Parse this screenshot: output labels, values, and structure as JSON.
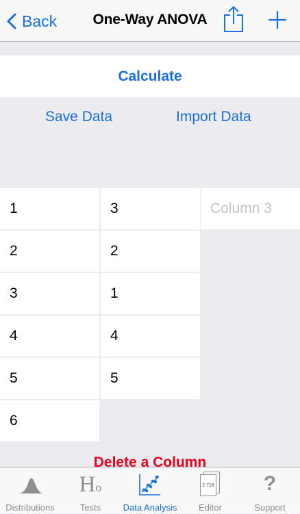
{
  "colors": {
    "accent": "#1a6fe0",
    "destructive": "#e8001c",
    "background": "#ebebf0",
    "placeholder": "#c4c4c8"
  },
  "nav": {
    "back_label": "Back",
    "title": "One-Way ANOVA",
    "share_icon": "share-icon",
    "add_icon": "plus-icon"
  },
  "actions": {
    "calculate": "Calculate",
    "save_data": "Save Data",
    "import_data": "Import Data",
    "delete_column": "Delete a Column"
  },
  "columns": [
    {
      "values": [
        "1",
        "2",
        "3",
        "4",
        "5",
        "6"
      ]
    },
    {
      "values": [
        "3",
        "2",
        "1",
        "4",
        "5"
      ]
    },
    {
      "placeholder": "Column 3",
      "values": []
    }
  ],
  "tabs": [
    {
      "label": "Distributions",
      "icon": "distribution-curve-icon",
      "active": false
    },
    {
      "label": "Tests",
      "icon": "hypothesis-icon",
      "glyph": "H",
      "subscript": "o",
      "active": false
    },
    {
      "label": "Data Analysis",
      "icon": "scatter-plot-icon",
      "active": true
    },
    {
      "label": "Editor",
      "icon": "document-editor-icon",
      "doc_text": "2.718",
      "active": false
    },
    {
      "label": "Support",
      "icon": "question-mark-icon",
      "glyph": "?",
      "active": false
    }
  ]
}
